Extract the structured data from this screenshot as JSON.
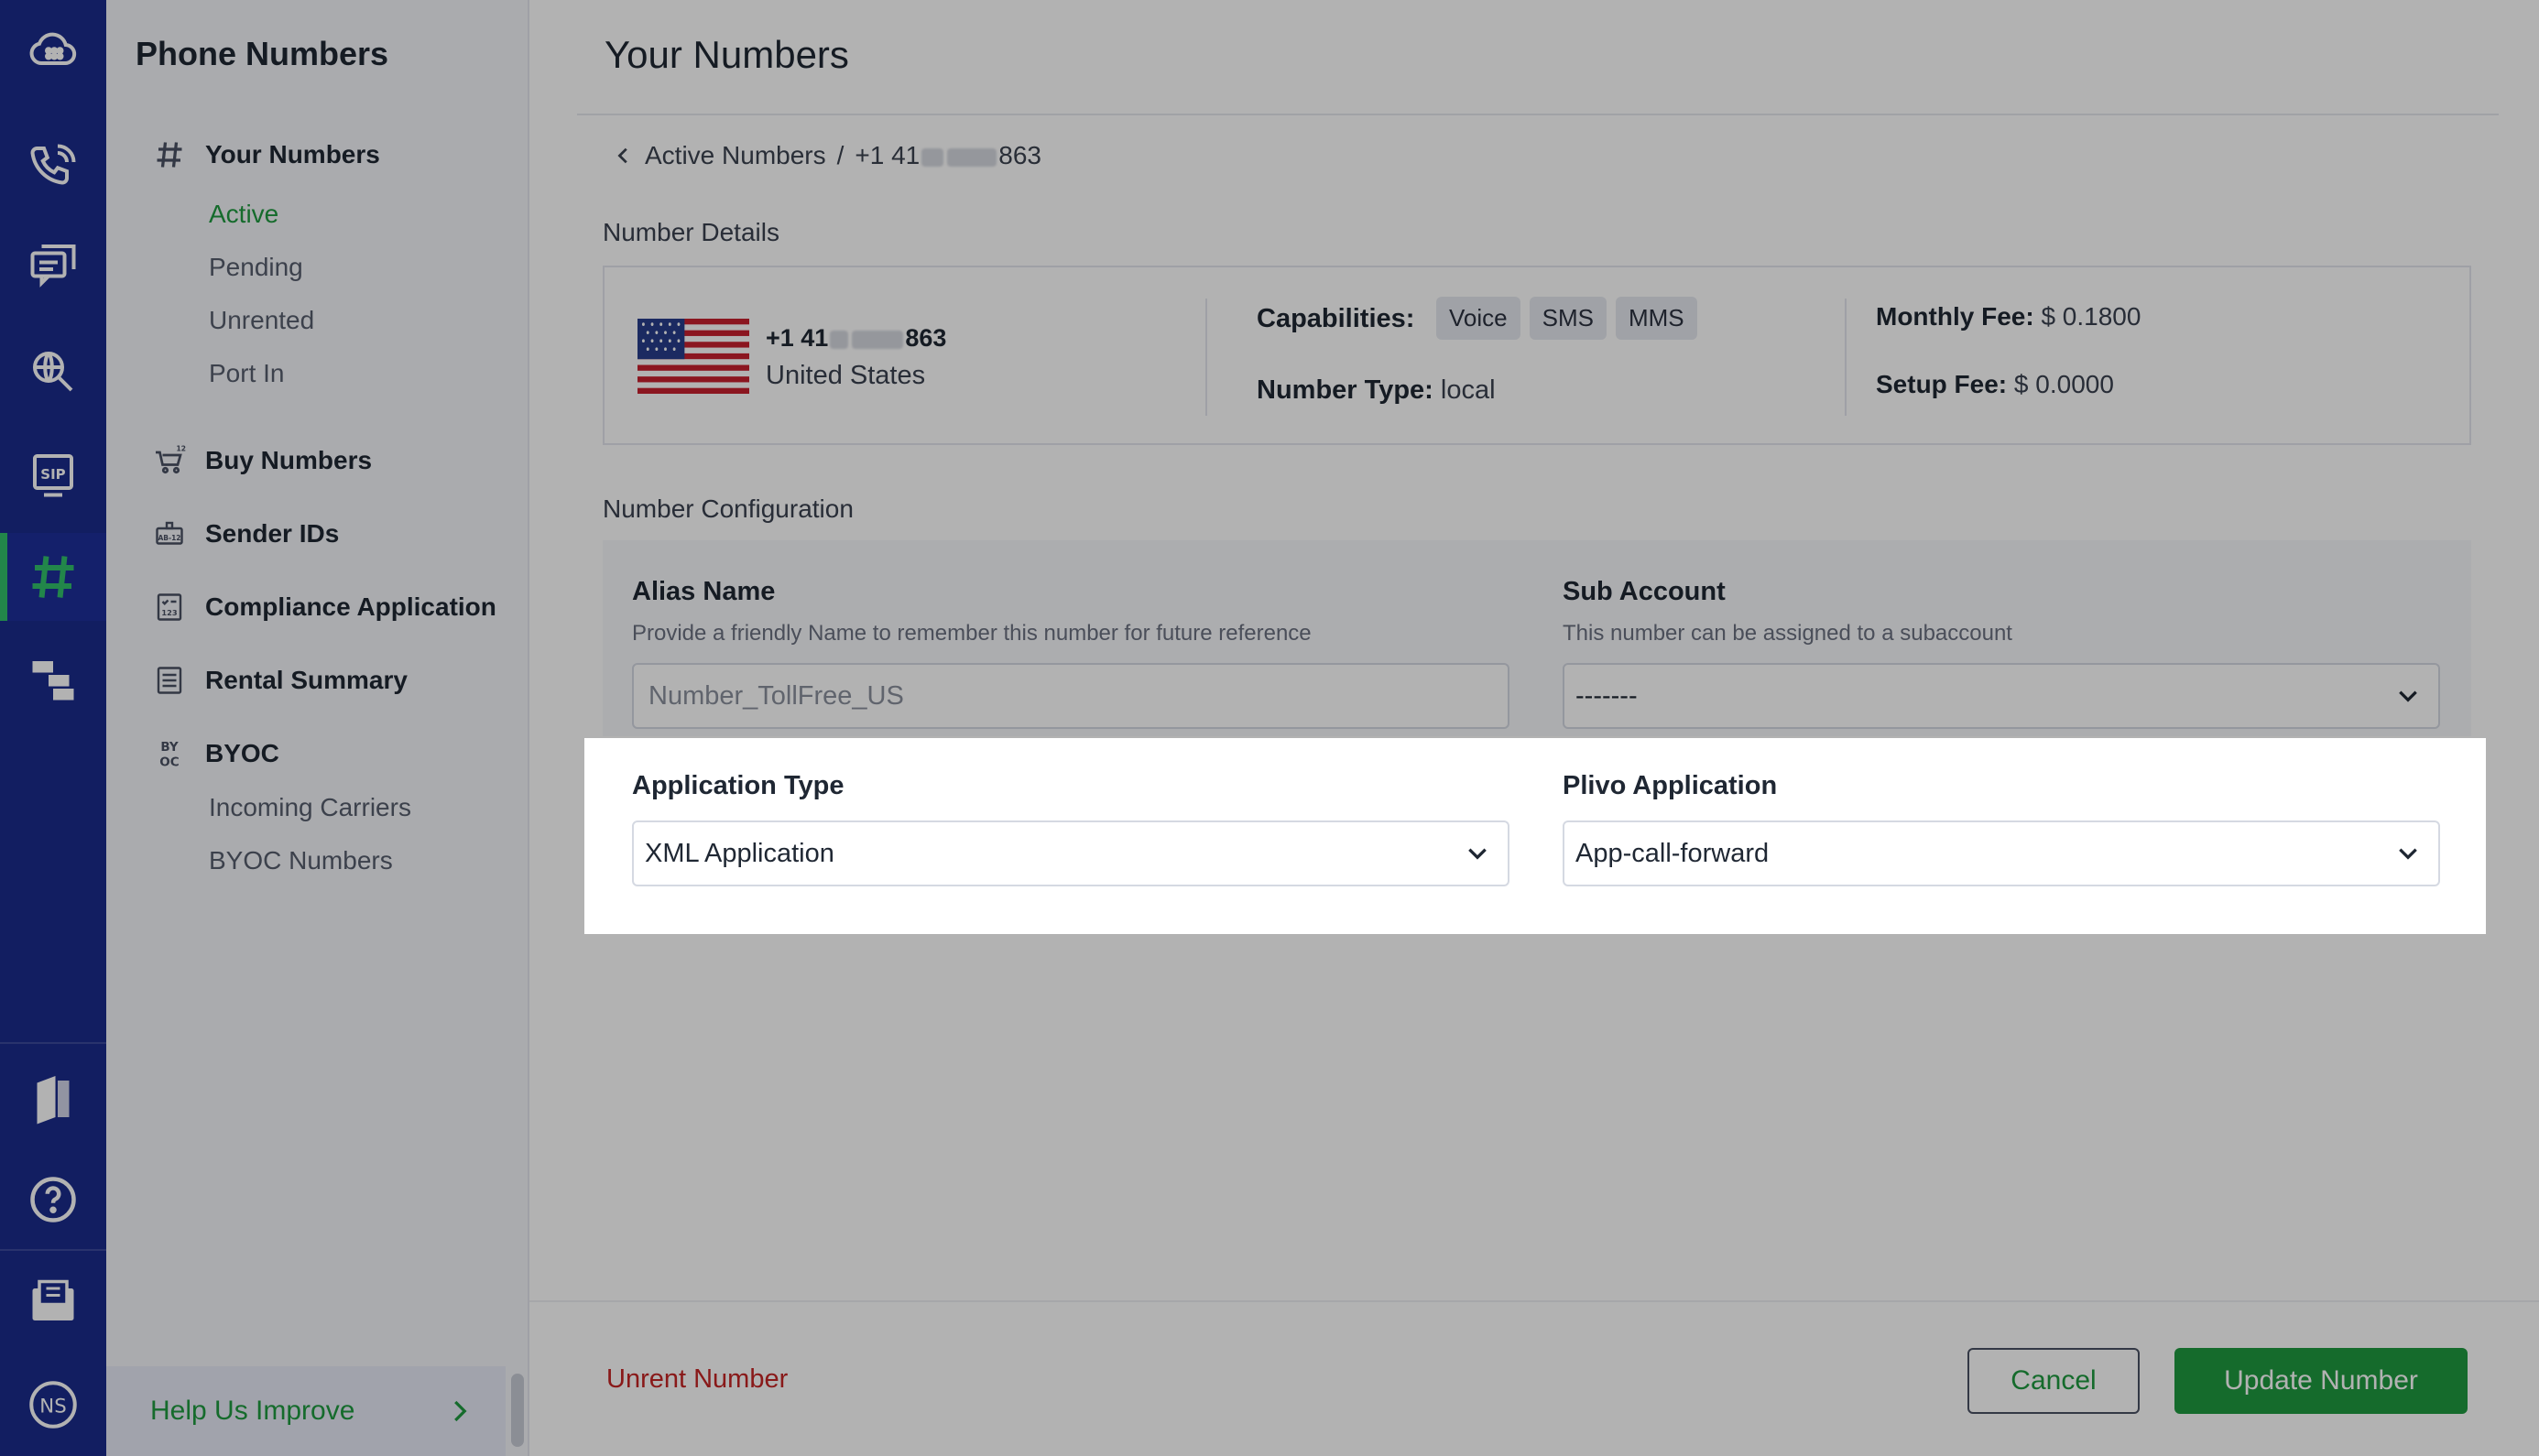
{
  "rail": {
    "icons": [
      "cloud-logo-icon",
      "phone-call-icon",
      "messaging-icon",
      "lookup-icon",
      "sip-icon",
      "hash-icon",
      "flow-icon",
      "docs-icon",
      "help-icon",
      "billing-icon",
      "account-icon"
    ],
    "account_initials": "NS"
  },
  "sidebar": {
    "title": "Phone Numbers",
    "your_numbers": "Your Numbers",
    "your_numbers_sub": [
      "Active",
      "Pending",
      "Unrented",
      "Port In"
    ],
    "buy_numbers": "Buy Numbers",
    "sender_ids": "Sender IDs",
    "compliance": "Compliance Application",
    "rental_summary": "Rental Summary",
    "byoc": "BYOC",
    "byoc_sub": [
      "Incoming Carriers",
      "BYOC Numbers"
    ],
    "help": "Help Us Improve"
  },
  "main": {
    "title": "Your Numbers",
    "breadcrumb": {
      "parent": "Active Numbers",
      "separator": "/",
      "number_prefix": "+1 41",
      "number_suffix": "863"
    },
    "details": {
      "section_label": "Number Details",
      "number_prefix": "+1 41",
      "number_suffix": "863",
      "country": "United States",
      "capabilities_label": "Capabilities:",
      "capabilities": [
        "Voice",
        "SMS",
        "MMS"
      ],
      "number_type_label": "Number Type:",
      "number_type": "local",
      "monthly_fee_label": "Monthly Fee:",
      "monthly_fee": "$ 0.1800",
      "setup_fee_label": "Setup Fee:",
      "setup_fee": "$ 0.0000"
    },
    "config": {
      "section_label": "Number Configuration",
      "alias_label": "Alias Name",
      "alias_help": "Provide a friendly Name to remember this number for future reference",
      "alias_placeholder": "Number_TollFree_US",
      "sub_account_label": "Sub Account",
      "sub_account_help": "This number can be assigned to a subaccount",
      "sub_account_value": "-------",
      "app_type_label": "Application Type",
      "app_type_value": "XML Application",
      "plivo_app_label": "Plivo Application",
      "plivo_app_value": "App-call-forward"
    },
    "footer": {
      "unrent": "Unrent Number",
      "cancel": "Cancel",
      "update": "Update Number"
    }
  },
  "colors": {
    "rail": "#1a2b8c",
    "accent_green": "#1f9a3f",
    "danger": "#c42525"
  }
}
